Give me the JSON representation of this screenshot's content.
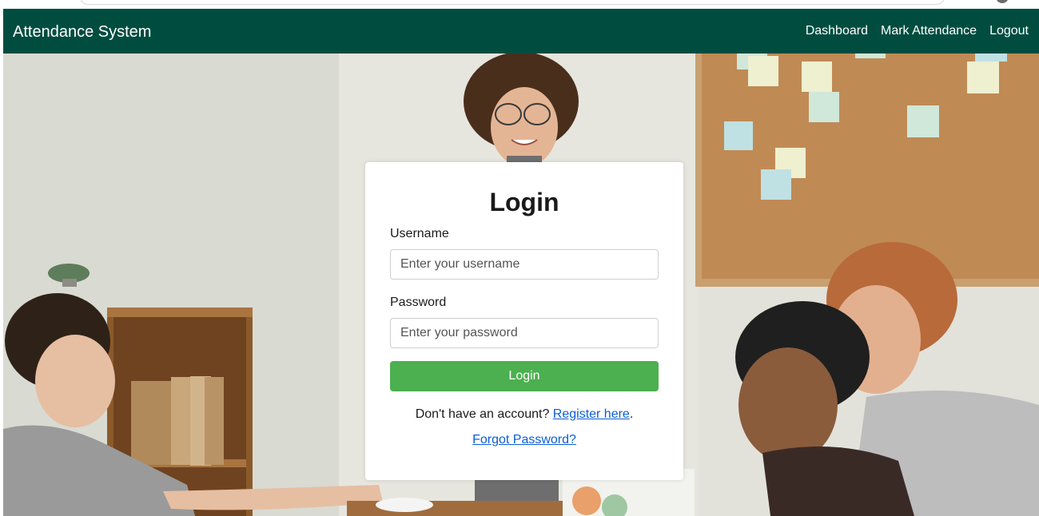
{
  "navbar": {
    "brand": "Attendance System",
    "links": [
      "Dashboard",
      "Mark Attendance",
      "Logout"
    ],
    "background": "#004d40"
  },
  "login": {
    "title": "Login",
    "username_label": "Username",
    "username_placeholder": "Enter your username",
    "password_label": "Password",
    "password_placeholder": "Enter your password",
    "submit_label": "Login",
    "register_prompt": "Don't have an account?",
    "register_link": "Register here",
    "register_suffix": ".",
    "forgot_link": "Forgot Password?",
    "button_color": "#4caf50",
    "link_color": "#0b5ed7"
  },
  "background_image": {
    "description_icon": "office-meeting-photo"
  }
}
